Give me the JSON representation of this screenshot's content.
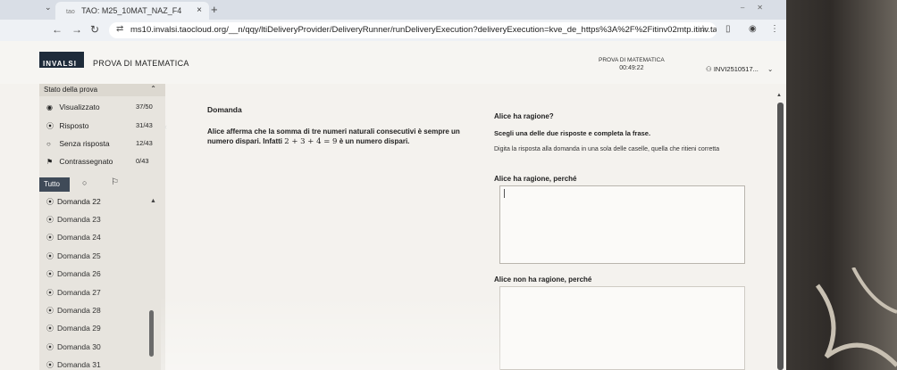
{
  "browser": {
    "tab_title": "TAO: M25_10MAT_NAZ_F4",
    "tab_favicon": "tao",
    "url": "ms10.invalsi.taocloud.org/__n/qqy/ltiDeliveryProvider/DeliveryRunner/runDeliveryExecution?deliveryExecution=kve_de_https%3A%2F%2Fitinv02mtp.itinv.taocloud.or..."
  },
  "header": {
    "logo_text": "INVALSI",
    "title": "PROVA DI MATEMATICA",
    "test_name": "PROVA DI MATEMATICA",
    "timer": "00:49:22",
    "user": "INVI2510517..."
  },
  "sidebar": {
    "heading": "Stato della prova",
    "stats": [
      {
        "label": "Visualizzato",
        "count": "37/50"
      },
      {
        "label": "Risposto",
        "count": "31/43"
      },
      {
        "label": "Senza risposta",
        "count": "12/43"
      },
      {
        "label": "Contrassegnato",
        "count": "0/43"
      }
    ],
    "filter_all": "Tutto",
    "questions": [
      "Domanda 22",
      "Domanda 23",
      "Domanda 24",
      "Domanda 25",
      "Domanda 26",
      "Domanda 27",
      "Domanda 28",
      "Domanda 29",
      "Domanda 30",
      "Domanda 31"
    ]
  },
  "question": {
    "label": "Domanda",
    "text_before": "Alice afferma che la somma di tre numeri naturali consecutivi è sempre un numero dispari. Infatti",
    "math": "2 + 3 + 4 = 9",
    "text_after": "è un numero dispari."
  },
  "answer": {
    "title": "Alice ha ragione?",
    "instruction": "Scegli una delle due risposte e completa la frase.",
    "hint": "Digita la risposta alla domanda in una sola delle caselle, quella che ritieni corretta",
    "option1": "Alice ha ragione, perché",
    "option2": "Alice non ha ragione, perché"
  }
}
